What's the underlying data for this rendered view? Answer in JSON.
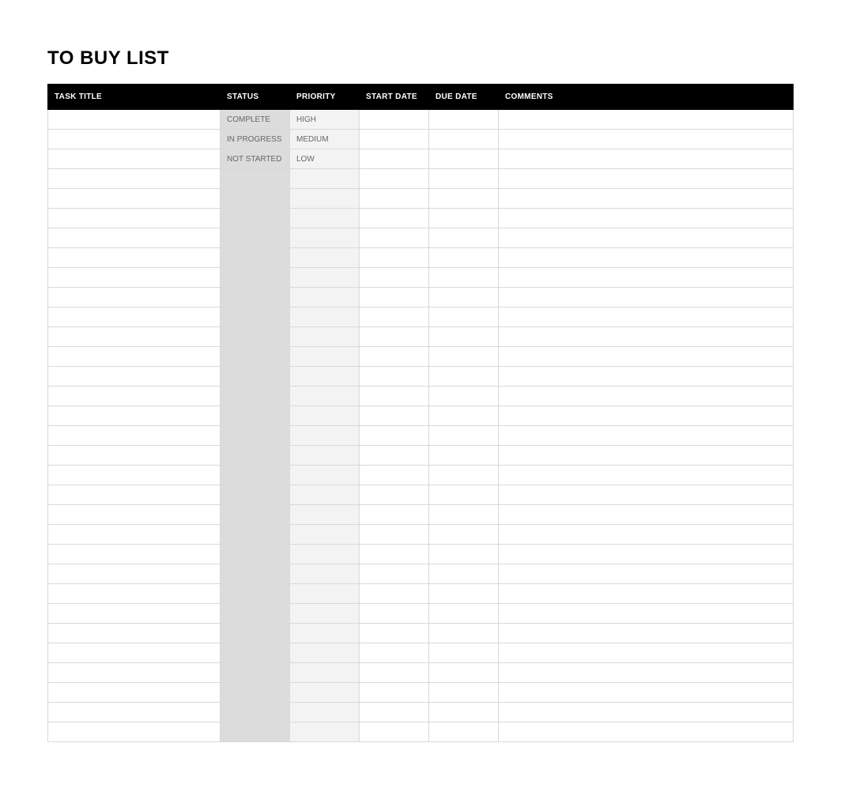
{
  "title": "TO BUY LIST",
  "headers": {
    "task_title": "TASK TITLE",
    "status": "STATUS",
    "priority": "PRIORITY",
    "start_date": "START DATE",
    "due_date": "DUE DATE",
    "comments": "COMMENTS"
  },
  "rows": [
    {
      "task_title": "",
      "status": "COMPLETE",
      "priority": "HIGH",
      "start_date": "",
      "due_date": "",
      "comments": ""
    },
    {
      "task_title": "",
      "status": "IN PROGRESS",
      "priority": "MEDIUM",
      "start_date": "",
      "due_date": "",
      "comments": ""
    },
    {
      "task_title": "",
      "status": "NOT STARTED",
      "priority": "LOW",
      "start_date": "",
      "due_date": "",
      "comments": ""
    },
    {
      "task_title": "",
      "status": "",
      "priority": "",
      "start_date": "",
      "due_date": "",
      "comments": ""
    },
    {
      "task_title": "",
      "status": "",
      "priority": "",
      "start_date": "",
      "due_date": "",
      "comments": ""
    },
    {
      "task_title": "",
      "status": "",
      "priority": "",
      "start_date": "",
      "due_date": "",
      "comments": ""
    },
    {
      "task_title": "",
      "status": "",
      "priority": "",
      "start_date": "",
      "due_date": "",
      "comments": ""
    },
    {
      "task_title": "",
      "status": "",
      "priority": "",
      "start_date": "",
      "due_date": "",
      "comments": ""
    },
    {
      "task_title": "",
      "status": "",
      "priority": "",
      "start_date": "",
      "due_date": "",
      "comments": ""
    },
    {
      "task_title": "",
      "status": "",
      "priority": "",
      "start_date": "",
      "due_date": "",
      "comments": ""
    },
    {
      "task_title": "",
      "status": "",
      "priority": "",
      "start_date": "",
      "due_date": "",
      "comments": ""
    },
    {
      "task_title": "",
      "status": "",
      "priority": "",
      "start_date": "",
      "due_date": "",
      "comments": ""
    },
    {
      "task_title": "",
      "status": "",
      "priority": "",
      "start_date": "",
      "due_date": "",
      "comments": ""
    },
    {
      "task_title": "",
      "status": "",
      "priority": "",
      "start_date": "",
      "due_date": "",
      "comments": ""
    },
    {
      "task_title": "",
      "status": "",
      "priority": "",
      "start_date": "",
      "due_date": "",
      "comments": ""
    },
    {
      "task_title": "",
      "status": "",
      "priority": "",
      "start_date": "",
      "due_date": "",
      "comments": ""
    },
    {
      "task_title": "",
      "status": "",
      "priority": "",
      "start_date": "",
      "due_date": "",
      "comments": ""
    },
    {
      "task_title": "",
      "status": "",
      "priority": "",
      "start_date": "",
      "due_date": "",
      "comments": ""
    },
    {
      "task_title": "",
      "status": "",
      "priority": "",
      "start_date": "",
      "due_date": "",
      "comments": ""
    },
    {
      "task_title": "",
      "status": "",
      "priority": "",
      "start_date": "",
      "due_date": "",
      "comments": ""
    },
    {
      "task_title": "",
      "status": "",
      "priority": "",
      "start_date": "",
      "due_date": "",
      "comments": ""
    },
    {
      "task_title": "",
      "status": "",
      "priority": "",
      "start_date": "",
      "due_date": "",
      "comments": ""
    },
    {
      "task_title": "",
      "status": "",
      "priority": "",
      "start_date": "",
      "due_date": "",
      "comments": ""
    },
    {
      "task_title": "",
      "status": "",
      "priority": "",
      "start_date": "",
      "due_date": "",
      "comments": ""
    },
    {
      "task_title": "",
      "status": "",
      "priority": "",
      "start_date": "",
      "due_date": "",
      "comments": ""
    },
    {
      "task_title": "",
      "status": "",
      "priority": "",
      "start_date": "",
      "due_date": "",
      "comments": ""
    },
    {
      "task_title": "",
      "status": "",
      "priority": "",
      "start_date": "",
      "due_date": "",
      "comments": ""
    },
    {
      "task_title": "",
      "status": "",
      "priority": "",
      "start_date": "",
      "due_date": "",
      "comments": ""
    },
    {
      "task_title": "",
      "status": "",
      "priority": "",
      "start_date": "",
      "due_date": "",
      "comments": ""
    },
    {
      "task_title": "",
      "status": "",
      "priority": "",
      "start_date": "",
      "due_date": "",
      "comments": ""
    },
    {
      "task_title": "",
      "status": "",
      "priority": "",
      "start_date": "",
      "due_date": "",
      "comments": ""
    },
    {
      "task_title": "",
      "status": "",
      "priority": "",
      "start_date": "",
      "due_date": "",
      "comments": ""
    }
  ]
}
